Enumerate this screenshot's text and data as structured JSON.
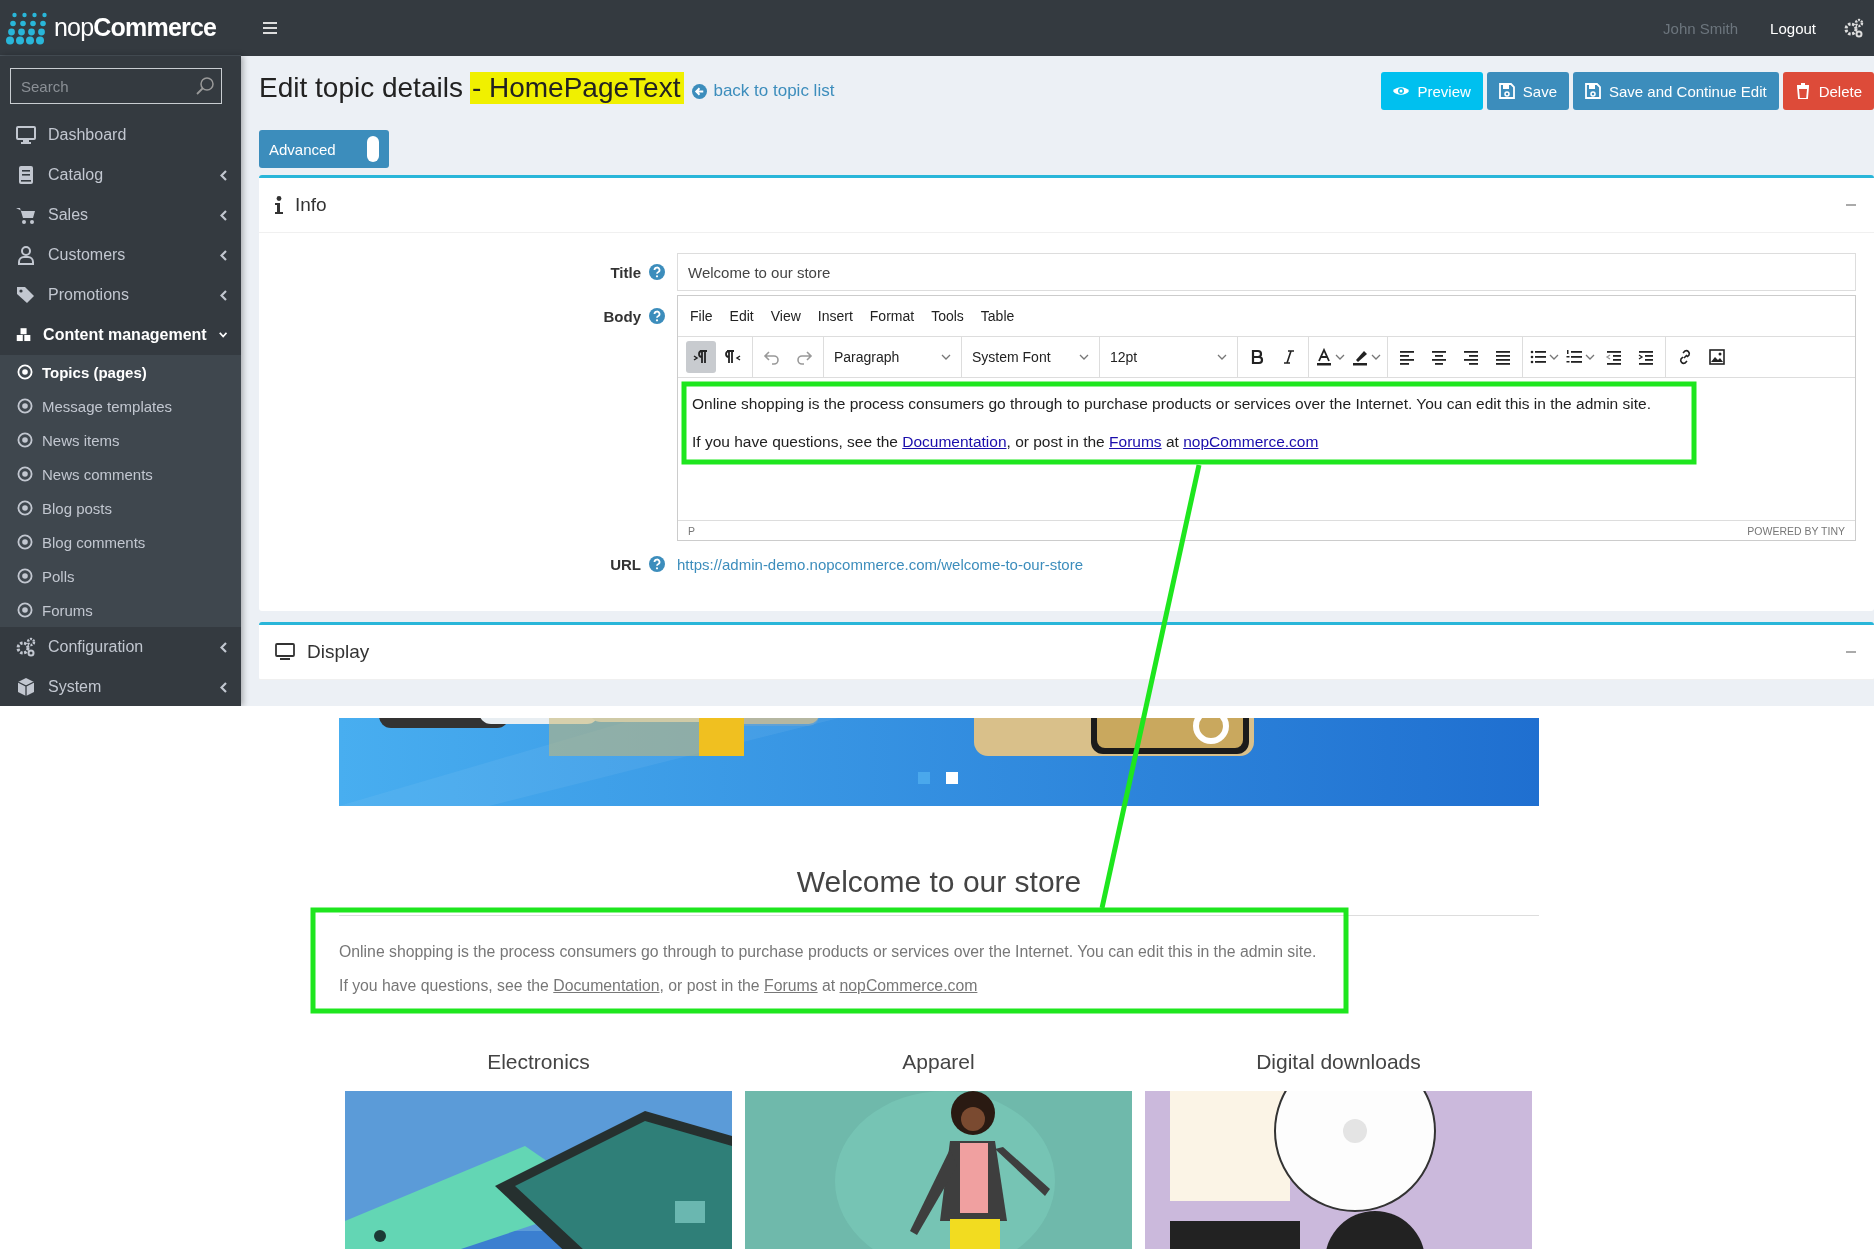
{
  "brand": "nop**Commerce**",
  "header": {
    "user": "John Smith",
    "logout": "Logout"
  },
  "sidebar": {
    "search": {
      "placeholder": "Search"
    },
    "items": [
      {
        "label": "Dashboard"
      },
      {
        "label": "Catalog",
        "expanded": false
      },
      {
        "label": "Sales",
        "expanded": false
      },
      {
        "label": "Customers",
        "expanded": false
      },
      {
        "label": "Promotions",
        "expanded": false
      },
      {
        "label": "Content management",
        "expanded": true,
        "children": [
          {
            "label": "Topics (pages)",
            "selected": true
          },
          {
            "label": "Message templates",
            "selected": false
          },
          {
            "label": "News items",
            "selected": false
          },
          {
            "label": "News comments",
            "selected": false
          },
          {
            "label": "Blog posts",
            "selected": false
          },
          {
            "label": "Blog comments",
            "selected": false
          },
          {
            "label": "Polls",
            "selected": false
          },
          {
            "label": "Forums",
            "selected": false
          }
        ]
      },
      {
        "label": "Configuration",
        "expanded": false
      },
      {
        "label": "System",
        "expanded": false
      }
    ]
  },
  "page": {
    "title": "Edit topic details",
    "topic": "- HomePageText",
    "topic_highlighted": true,
    "back_link": "back to topic list",
    "buttons": [
      {
        "label": "Preview",
        "kind": "info"
      },
      {
        "label": "Save",
        "kind": "primary"
      },
      {
        "label": "Save and Continue Edit",
        "kind": "primary"
      },
      {
        "label": "Delete",
        "kind": "danger"
      }
    ],
    "advanced": {
      "label": "Advanced",
      "on": true
    }
  },
  "info_panel": {
    "title": "Info",
    "fields": [
      {
        "kind": "text",
        "label": "Title",
        "value": "Welcome to our store"
      },
      {
        "kind": "editor",
        "label": "Body"
      },
      {
        "kind": "link",
        "label": "URL",
        "value": "https://admin-demo.nopcommerce.com/welcome-to-our-store"
      }
    ]
  },
  "editor": {
    "menu": [
      "File",
      "Edit",
      "View",
      "Insert",
      "Format",
      "Tools",
      "Table"
    ],
    "direction_buttons": [
      {
        "pressed": true
      },
      {
        "pressed": false
      }
    ],
    "dropdowns": [
      "Paragraph",
      "System Font",
      "12pt"
    ],
    "paragraphs": [
      [
        {
          "text": "Online shopping is the process consumers go through to purchase products or services over the Internet. You can edit this in the admin site."
        }
      ],
      [
        {
          "text": "If you have questions, see the "
        },
        {
          "text": "Documentation",
          "link": true
        },
        {
          "text": ", or post in the "
        },
        {
          "text": "Forums",
          "link": true
        },
        {
          "text": " at "
        },
        {
          "text": "nopCommerce.com",
          "link": true
        }
      ]
    ],
    "status_path": "P",
    "branding": "POWERED BY TINY"
  },
  "display_panel": {
    "title": "Display"
  },
  "storefront": {
    "slides": [
      {
        "selected": false
      },
      {
        "selected": true
      }
    ],
    "title": "Welcome to our store",
    "paragraphs": [
      [
        {
          "text": "Online shopping is the process consumers go through to purchase products or services over the Internet. You can edit this in the admin site."
        }
      ],
      [
        {
          "text": "If you have questions, see the "
        },
        {
          "text": "Documentation",
          "link": true
        },
        {
          "text": ", or post in the "
        },
        {
          "text": "Forums",
          "link": true
        },
        {
          "text": " at "
        },
        {
          "text": "nopCommerce.com",
          "link": true
        }
      ]
    ],
    "categories": [
      {
        "name": "Electronics"
      },
      {
        "name": "Apparel"
      },
      {
        "name": "Digital downloads"
      }
    ]
  }
}
